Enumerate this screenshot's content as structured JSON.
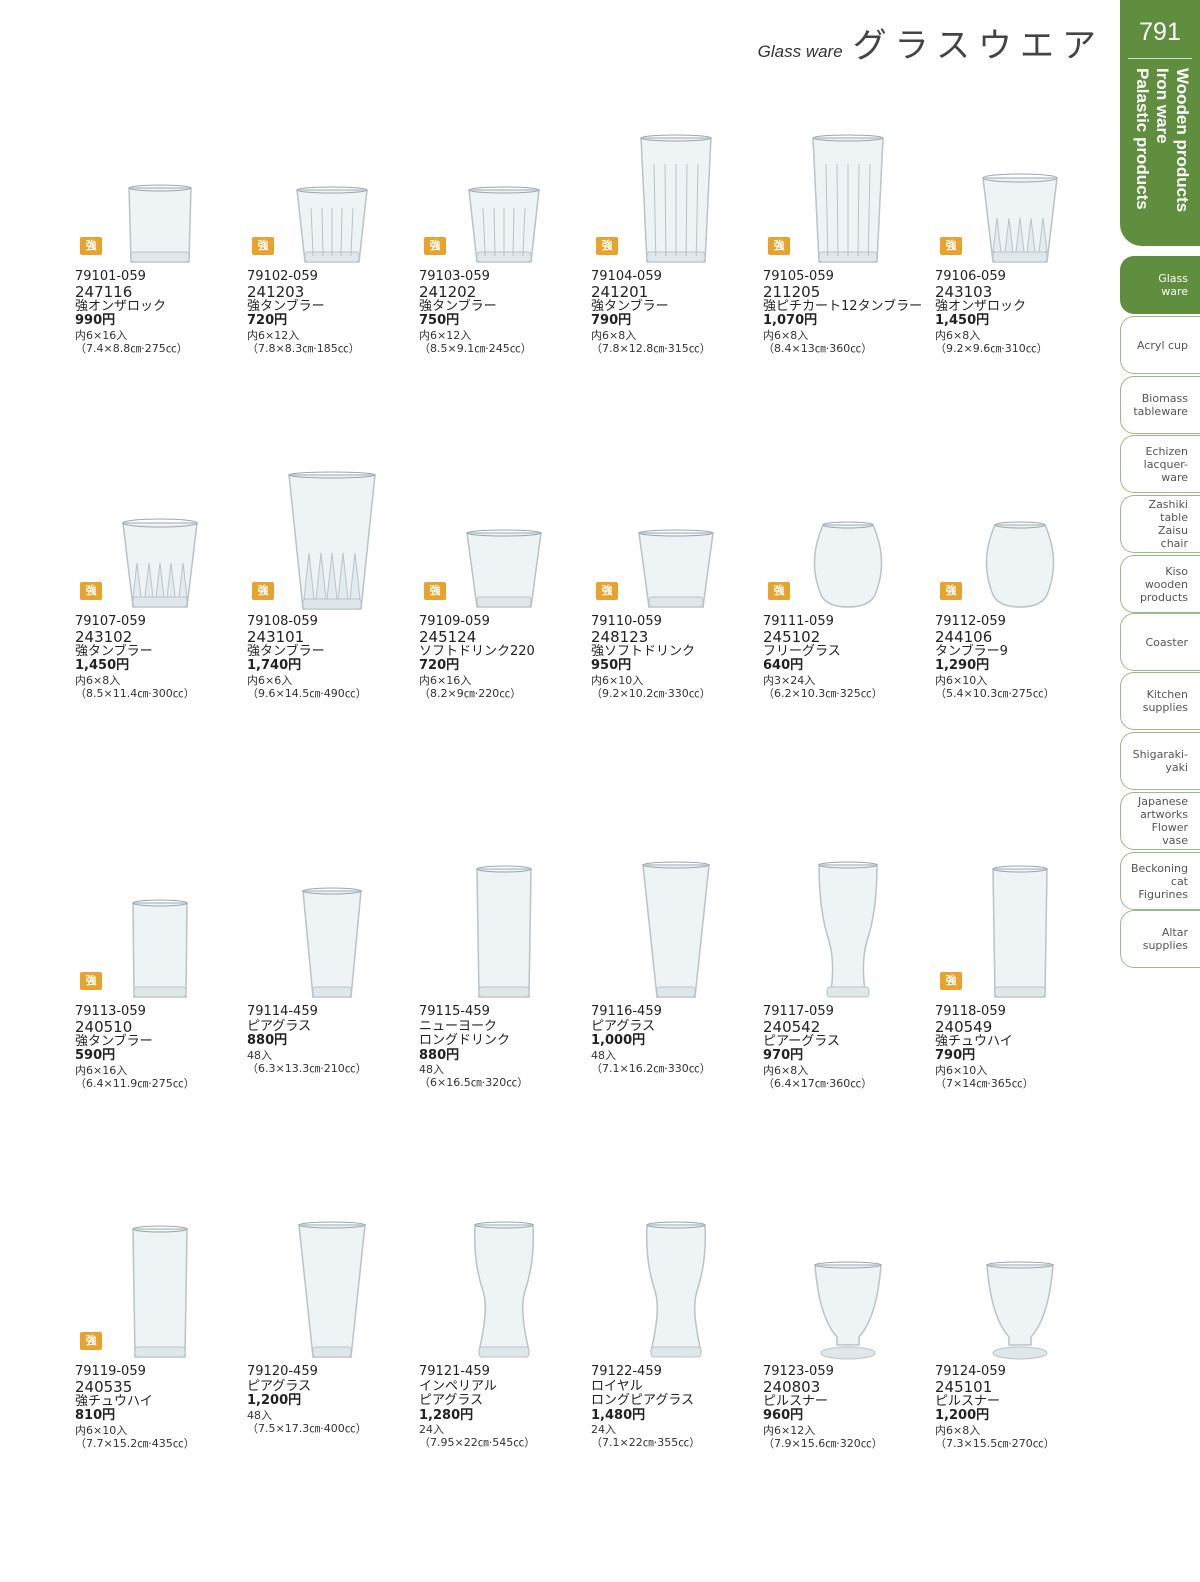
{
  "header": {
    "en": "Glass ware",
    "jp": "グラスウエア"
  },
  "rail": {
    "page_number": "791",
    "vertical_title": [
      "Wooden products",
      "Iron ware",
      "Palastic products"
    ],
    "tabs": [
      {
        "label": "Glass\nware",
        "active": true
      },
      {
        "label": "Acryl cup",
        "active": false
      },
      {
        "label": "Biomass\ntableware",
        "active": false
      },
      {
        "label": "Echizen\nlacquer-\nware",
        "active": false
      },
      {
        "label": "Zashiki\ntable\nZaisu\nchair",
        "active": false
      },
      {
        "label": "Kiso\nwooden\nproducts",
        "active": false
      },
      {
        "label": "Coaster",
        "active": false
      },
      {
        "label": "Kitchen\nsupplies",
        "active": false
      },
      {
        "label": "Shigaraki-\nyaki",
        "active": false
      },
      {
        "label": "Japanese\nartworks\nFlower\nvase",
        "active": false
      },
      {
        "label": "Beckoning\ncat\nFigurines",
        "active": false
      },
      {
        "label": "Altar\nsupplies",
        "active": false
      }
    ]
  },
  "badge_label": "強",
  "products": [
    {
      "code": "79101-059",
      "num": "247116",
      "name": "強オンザロック",
      "price": "990円",
      "pack": "内6×16入",
      "dim": "（7.4×8.8㎝·275㏄）",
      "strong": true,
      "shape": "rocks"
    },
    {
      "code": "79102-059",
      "num": "241203",
      "name": "強タンブラー",
      "price": "720円",
      "pack": "内6×12入",
      "dim": "（7.8×8.3㎝·185㏄）",
      "strong": true,
      "shape": "paneled"
    },
    {
      "code": "79103-059",
      "num": "241202",
      "name": "強タンブラー",
      "price": "750円",
      "pack": "内6×12入",
      "dim": "（8.5×9.1㎝·245㏄）",
      "strong": true,
      "shape": "paneled"
    },
    {
      "code": "79104-059",
      "num": "241201",
      "name": "強タンブラー",
      "price": "790円",
      "pack": "内6×8入",
      "dim": "（7.8×12.8㎝·315㏄）",
      "strong": true,
      "shape": "paneled-tall"
    },
    {
      "code": "79105-059",
      "num": "211205",
      "name": "強ピチカート12タンブラー",
      "price": "1,070円",
      "pack": "内6×8入",
      "dim": "（8.4×13㎝·360㏄）",
      "strong": true,
      "shape": "paneled-tall"
    },
    {
      "code": "79106-059",
      "num": "243103",
      "name": "強オンザロック",
      "price": "1,450円",
      "pack": "内6×8入",
      "dim": "（9.2×9.6㎝·310㏄）",
      "strong": true,
      "shape": "cut"
    },
    {
      "code": "79107-059",
      "num": "243102",
      "name": "強タンブラー",
      "price": "1,450円",
      "pack": "内6×8入",
      "dim": "（8.5×11.4㎝·300㏄）",
      "strong": true,
      "shape": "cut"
    },
    {
      "code": "79108-059",
      "num": "243101",
      "name": "強タンブラー",
      "price": "1,740円",
      "pack": "内6×6入",
      "dim": "（9.6×14.5㎝·490㏄）",
      "strong": true,
      "shape": "cut-tall"
    },
    {
      "code": "79109-059",
      "num": "245124",
      "name": "ソフトドリンク220",
      "price": "720円",
      "pack": "内6×16入",
      "dim": "（8.2×9㎝·220㏄）",
      "strong": true,
      "shape": "tumbler-flare"
    },
    {
      "code": "79110-059",
      "num": "248123",
      "name": "強ソフトドリンク",
      "price": "950円",
      "pack": "内6×10入",
      "dim": "（9.2×10.2㎝·330㏄）",
      "strong": true,
      "shape": "tumbler-flare"
    },
    {
      "code": "79111-059",
      "num": "245102",
      "name": "フリーグラス",
      "price": "640円",
      "pack": "内3×24入",
      "dim": "（6.2×10.3㎝·325㏄）",
      "strong": true,
      "shape": "barrel"
    },
    {
      "code": "79112-059",
      "num": "244106",
      "name": "タンブラー9",
      "price": "1,290円",
      "pack": "内6×10入",
      "dim": "（5.4×10.3㎝·275㏄）",
      "strong": true,
      "shape": "barrel"
    },
    {
      "code": "79113-059",
      "num": "240510",
      "name": "強タンブラー",
      "price": "590円",
      "pack": "内6×16入",
      "dim": "（6.4×11.9㎝·275㏄）",
      "strong": true,
      "shape": "straight"
    },
    {
      "code": "79114-459",
      "num": "",
      "name": "ピアグラス",
      "price": "880円",
      "pack": "48入",
      "dim": "（6.3×13.3㎝·210㏄）",
      "strong": false,
      "shape": "taper"
    },
    {
      "code": "79115-459",
      "num": "",
      "name": "ニューヨーク\nロングドリンク",
      "price": "880円",
      "pack": "48入",
      "dim": "（6×16.5㎝·320㏄）",
      "strong": false,
      "shape": "straight-tall"
    },
    {
      "code": "79116-459",
      "num": "",
      "name": "ピアグラス",
      "price": "1,000円",
      "pack": "48入",
      "dim": "（7.1×16.2㎝·330㏄）",
      "strong": false,
      "shape": "taper-tall"
    },
    {
      "code": "79117-059",
      "num": "240542",
      "name": "ピアーグラス",
      "price": "970円",
      "pack": "内6×8入",
      "dim": "（6.4×17㎝·360㏄）",
      "strong": false,
      "shape": "pilsner"
    },
    {
      "code": "79118-059",
      "num": "240549",
      "name": "強チュウハイ",
      "price": "790円",
      "pack": "内6×10入",
      "dim": "（7×14㎝·365㏄）",
      "strong": true,
      "shape": "straight-tall"
    },
    {
      "code": "79119-059",
      "num": "240535",
      "name": "強チュウハイ",
      "price": "810円",
      "pack": "内6×10入",
      "dim": "（7.7×15.2㎝·435㏄）",
      "strong": true,
      "shape": "straight-tall"
    },
    {
      "code": "79120-459",
      "num": "",
      "name": "ピアグラス",
      "price": "1,200円",
      "pack": "48入",
      "dim": "（7.5×17.3㎝·400㏄）",
      "strong": false,
      "shape": "taper-tall"
    },
    {
      "code": "79121-459",
      "num": "",
      "name": "インペリアル\nピアグラス",
      "price": "1,280円",
      "pack": "24入",
      "dim": "（7.95×22㎝·545㏄）",
      "strong": false,
      "shape": "weizen"
    },
    {
      "code": "79122-459",
      "num": "",
      "name": "ロイヤル\nロングピアグラス",
      "price": "1,480円",
      "pack": "24入",
      "dim": "（7.1×22㎝·355㏄）",
      "strong": false,
      "shape": "weizen"
    },
    {
      "code": "79123-059",
      "num": "240803",
      "name": "ピルスナー",
      "price": "960円",
      "pack": "内6×12入",
      "dim": "（7.9×15.6㎝·320㏄）",
      "strong": false,
      "shape": "footed"
    },
    {
      "code": "79124-059",
      "num": "245101",
      "name": "ピルスナー",
      "price": "1,200円",
      "pack": "内6×8入",
      "dim": "（7.3×15.5㎝·270㏄）",
      "strong": false,
      "shape": "footed"
    }
  ]
}
